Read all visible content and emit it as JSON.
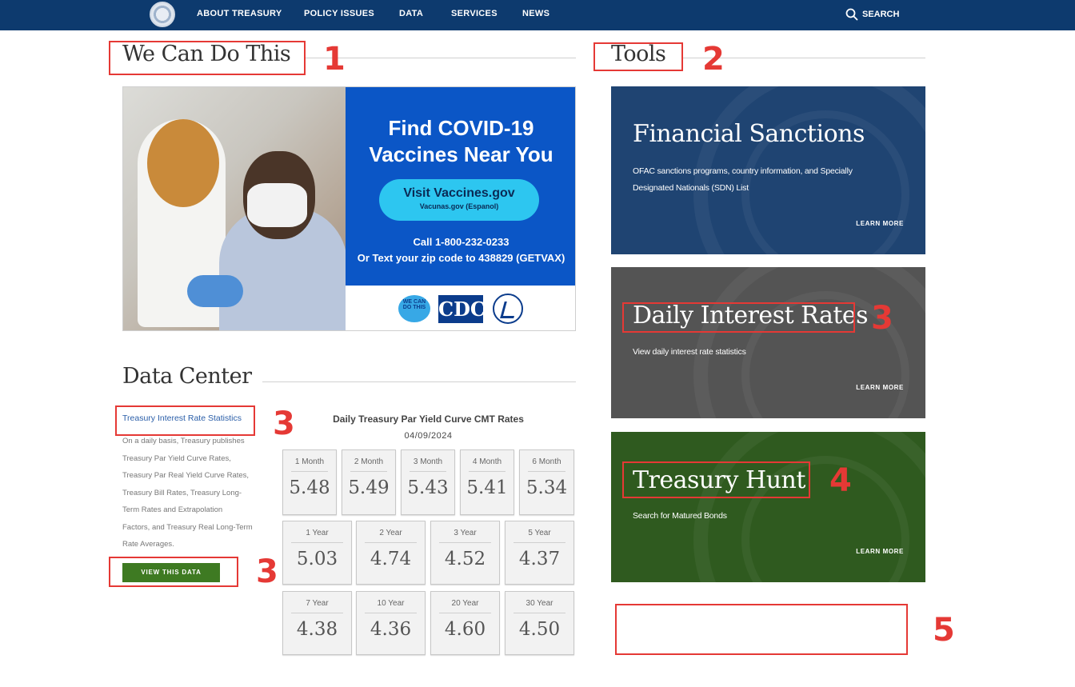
{
  "nav": {
    "items": [
      "ABOUT TREASURY",
      "POLICY ISSUES",
      "DATA",
      "SERVICES",
      "NEWS"
    ],
    "search_label": "SEARCH"
  },
  "sections": {
    "we_can": "We Can Do This",
    "tools": "Tools",
    "data_center": "Data Center"
  },
  "banner": {
    "headline_1": "Find COVID-19",
    "headline_2": "Vaccines Near You",
    "pill_main": "Visit Vaccines.gov",
    "pill_sub": "Vacunas.gov (Espanol)",
    "call": "Call 1-800-232-0233",
    "text": "Or Text your zip code to 438829 (GETVAX)",
    "wecan_logo": "WE CAN DO THIS",
    "cdc_logo": "CDC"
  },
  "data_center": {
    "link": "Treasury Interest Rate Statistics",
    "desc_lines": [
      "On a daily basis, Treasury publishes",
      "Treasury Par Yield Curve Rates,",
      "Treasury Par Real Yield Curve Rates,",
      "Treasury Bill Rates, Treasury Long-",
      "Term Rates and Extrapolation",
      "Factors, and Treasury Real Long-Term",
      "Rate Averages."
    ],
    "button": "VIEW THIS DATA",
    "chart_title": "Daily Treasury Par Yield Curve CMT Rates",
    "date": "04/09/2024",
    "rates": [
      {
        "term": "1 Month",
        "value": "5.48"
      },
      {
        "term": "2 Month",
        "value": "5.49"
      },
      {
        "term": "3 Month",
        "value": "5.43"
      },
      {
        "term": "4 Month",
        "value": "5.41"
      },
      {
        "term": "6 Month",
        "value": "5.34"
      },
      {
        "term": "1 Year",
        "value": "5.03"
      },
      {
        "term": "2 Year",
        "value": "4.74"
      },
      {
        "term": "3 Year",
        "value": "4.52"
      },
      {
        "term": "5 Year",
        "value": "4.37"
      },
      {
        "term": "7 Year",
        "value": "4.38"
      },
      {
        "term": "10 Year",
        "value": "4.36"
      },
      {
        "term": "20 Year",
        "value": "4.60"
      },
      {
        "term": "30 Year",
        "value": "4.50"
      }
    ]
  },
  "tools": [
    {
      "title": "Financial Sanctions",
      "desc_1": "OFAC sanctions programs, country information, and Specially",
      "desc_2": "Designated Nationals (SDN) List",
      "learn": "LEARN MORE",
      "color": "#1f4472"
    },
    {
      "title": "Daily Interest Rates",
      "desc_1": "View daily interest rate statistics",
      "desc_2": "",
      "learn": "LEARN MORE",
      "color": "#545454"
    },
    {
      "title": "Treasury Hunt",
      "desc_1": "Search for Matured Bonds",
      "desc_2": "",
      "learn": "LEARN MORE",
      "color": "#2f5a1f"
    }
  ],
  "annotations": {
    "n1": "1",
    "n2": "2",
    "n3a": "3",
    "n3b": "3",
    "n3c": "3",
    "n4": "4",
    "n5": "5",
    "color": "#e53935"
  }
}
